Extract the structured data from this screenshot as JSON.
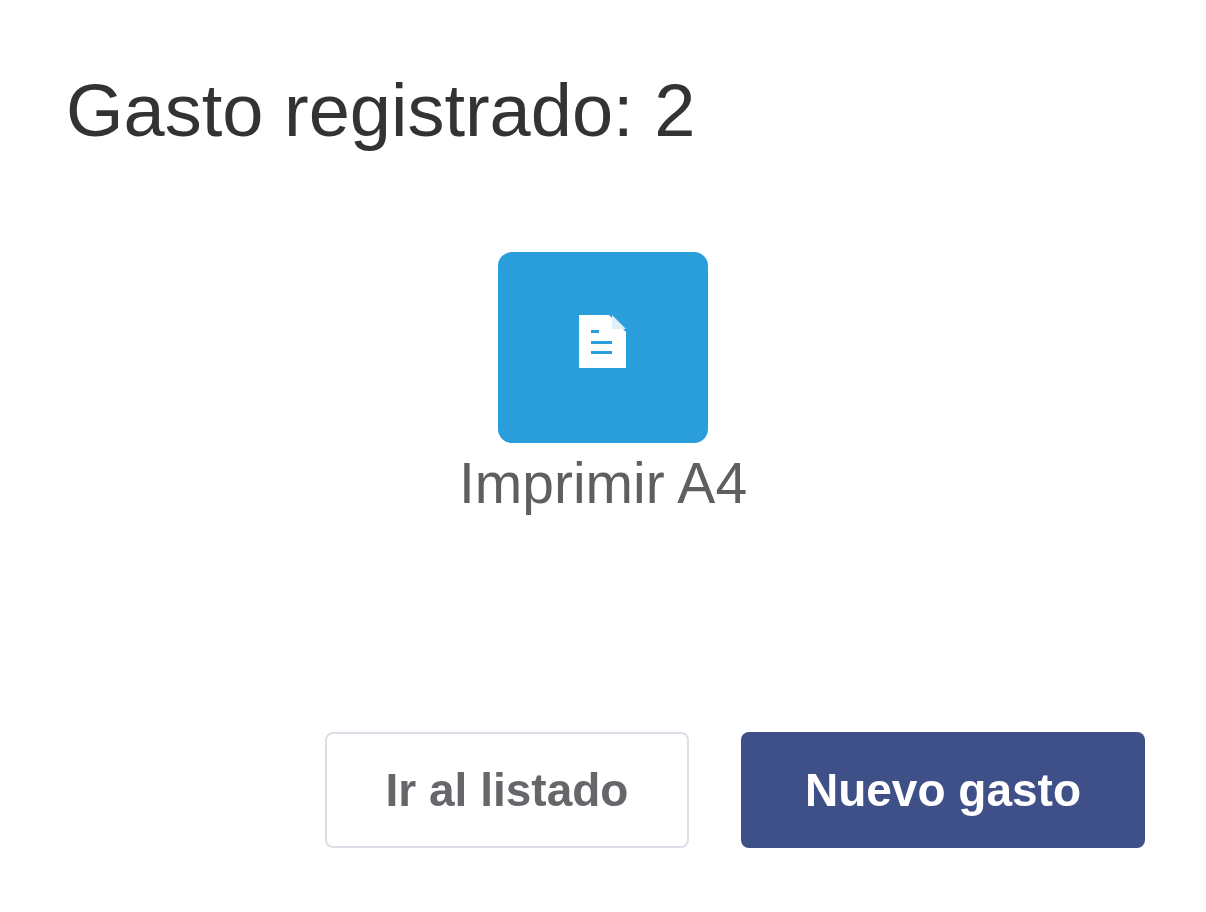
{
  "dialog": {
    "title": "Gasto registrado: 2",
    "actions": [
      {
        "label": "Imprimir A4",
        "kind": "print"
      }
    ],
    "buttons": [
      {
        "label": "Ir al listado",
        "kind": "secondary"
      },
      {
        "label": "Nuevo gasto",
        "kind": "primary"
      }
    ]
  }
}
